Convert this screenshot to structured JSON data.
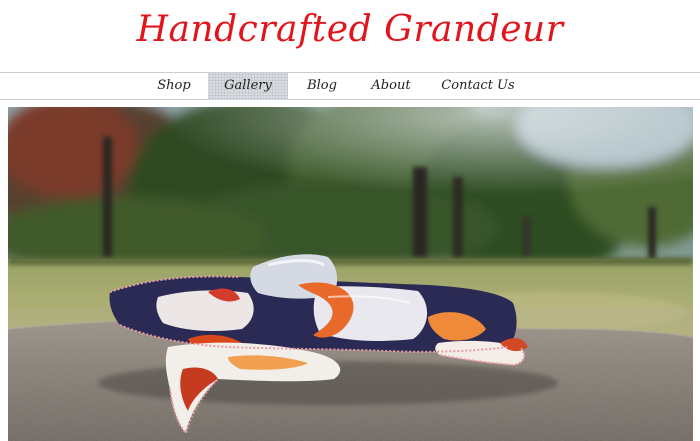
{
  "site": {
    "title": "Handcrafted Grandeur"
  },
  "nav": {
    "items": [
      {
        "label": "Shop",
        "active": false
      },
      {
        "label": "Gallery",
        "active": true
      },
      {
        "label": "Blog",
        "active": false
      },
      {
        "label": "About",
        "active": false
      },
      {
        "label": "Contact Us",
        "active": false
      }
    ]
  },
  "colors": {
    "title": "#e2151c",
    "nav_active_bg": "#d8dbe0",
    "divider": "#c9cdd6"
  }
}
